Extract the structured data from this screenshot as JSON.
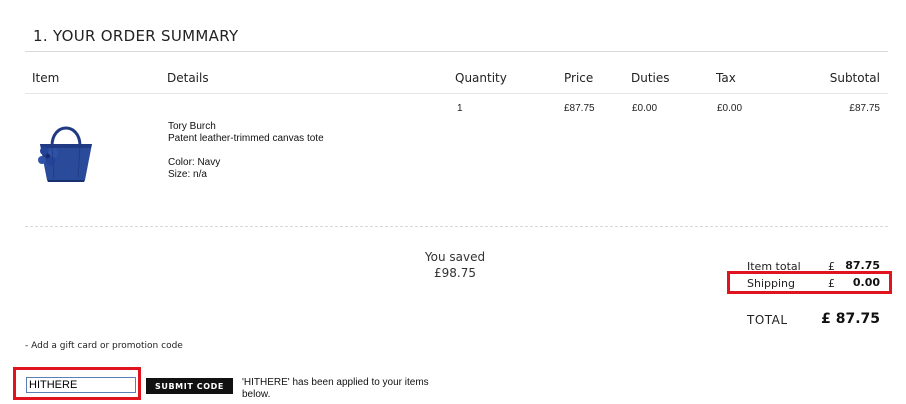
{
  "order_summary": {
    "title": "1. YOUR ORDER SUMMARY",
    "columns": {
      "item": "Item",
      "details": "Details",
      "quantity": "Quantity",
      "price": "Price",
      "duties": "Duties",
      "tax": "Tax",
      "subtotal": "Subtotal"
    },
    "line_item": {
      "brand": "Tory Burch",
      "name": "Patent leather-trimmed canvas tote",
      "color": "Color: Navy",
      "size": "Size: n/a",
      "quantity": "1",
      "price": "£87.75",
      "duties": "£0.00",
      "tax": "£0.00",
      "subtotal": "£87.75",
      "product_color": "#2a4a9a"
    }
  },
  "savings": {
    "label": "You saved",
    "amount": "£98.75"
  },
  "totals": {
    "item_total_label": "Item total",
    "item_total_currency": "£",
    "item_total_value": "87.75",
    "shipping_label": "Shipping",
    "shipping_currency": "£",
    "shipping_value": "0.00",
    "total_label": "TOTAL",
    "total_value": "£ 87.75"
  },
  "promo": {
    "link_text": "- Add a gift card or promotion code",
    "input_value": "HITHERE",
    "submit_label": "SUBMIT CODE",
    "applied_message": "'HITHERE' has been applied to your items below."
  },
  "colors": {
    "highlight": "#e0141e",
    "button_bg": "#111111"
  }
}
